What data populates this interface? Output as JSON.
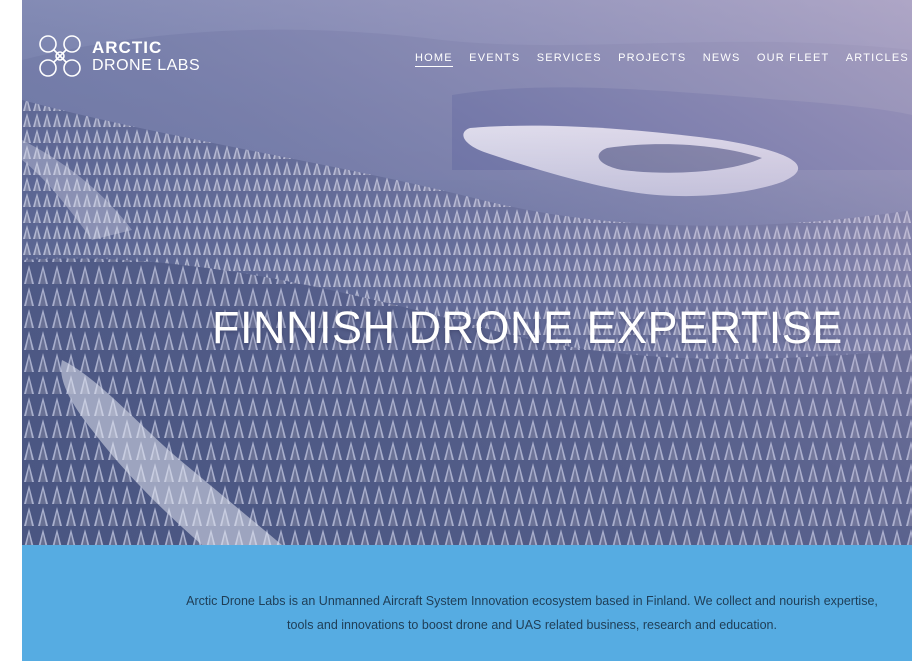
{
  "brand": {
    "line1": "ARCTIC",
    "line2": "DRONE LABS"
  },
  "nav": {
    "items": [
      {
        "label": "HOME",
        "active": true
      },
      {
        "label": "EVENTS",
        "active": false
      },
      {
        "label": "SERVICES",
        "active": false
      },
      {
        "label": "PROJECTS",
        "active": false
      },
      {
        "label": "NEWS",
        "active": false
      },
      {
        "label": "OUR FLEET",
        "active": false
      },
      {
        "label": "ARTICLES",
        "active": false
      }
    ]
  },
  "hero": {
    "headline": "FINNISH DRONE EXPERTISE",
    "image": "snowy-forest-lake-aerial"
  },
  "intro": {
    "text": "Arctic Drone Labs is an Unmanned Aircraft System Innovation ecosystem based in Finland. We collect and nourish expertise, tools and innovations to boost drone and UAS related business, research and education."
  },
  "colors": {
    "band": "#56ace2",
    "band_text": "#1f3d55",
    "hero_overlay": "#4f5b88",
    "nav_text": "#ffffff"
  }
}
